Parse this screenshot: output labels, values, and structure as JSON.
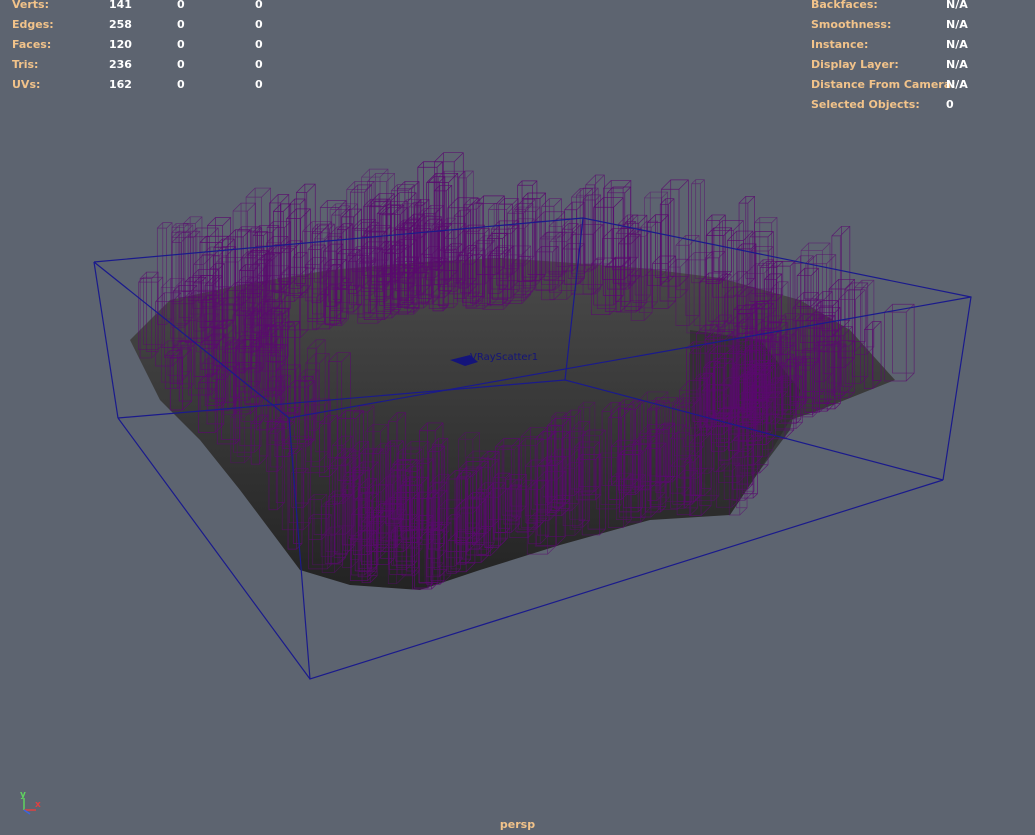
{
  "hud_left": {
    "rows": [
      {
        "label": "Verts:",
        "v1": "141",
        "v2": "0",
        "v3": "0"
      },
      {
        "label": "Edges:",
        "v1": "258",
        "v2": "0",
        "v3": "0"
      },
      {
        "label": "Faces:",
        "v1": "120",
        "v2": "0",
        "v3": "0"
      },
      {
        "label": "Tris:",
        "v1": "236",
        "v2": "0",
        "v3": "0"
      },
      {
        "label": "UVs:",
        "v1": "162",
        "v2": "0",
        "v3": "0"
      }
    ]
  },
  "hud_right": {
    "rows": [
      {
        "label": "Backfaces:",
        "value": "N/A"
      },
      {
        "label": "Smoothness:",
        "value": "N/A"
      },
      {
        "label": "Instance:",
        "value": "N/A"
      },
      {
        "label": "Display Layer:",
        "value": "N/A"
      },
      {
        "label": "Distance From Camera:",
        "value": "N/A"
      },
      {
        "label": "Selected Objects:",
        "value": "0"
      }
    ]
  },
  "scene": {
    "object_label": "VRayScatter1",
    "camera": "persp",
    "axis": {
      "y": "y",
      "x": "x"
    }
  },
  "colors": {
    "background": "#5d6470",
    "hud_label": "#f2c38a",
    "hud_value": "#ffffff",
    "bounding_box": "#1a1a8c",
    "instance_wire": "#5a0a6e",
    "terrain": "#3a3a3a"
  }
}
